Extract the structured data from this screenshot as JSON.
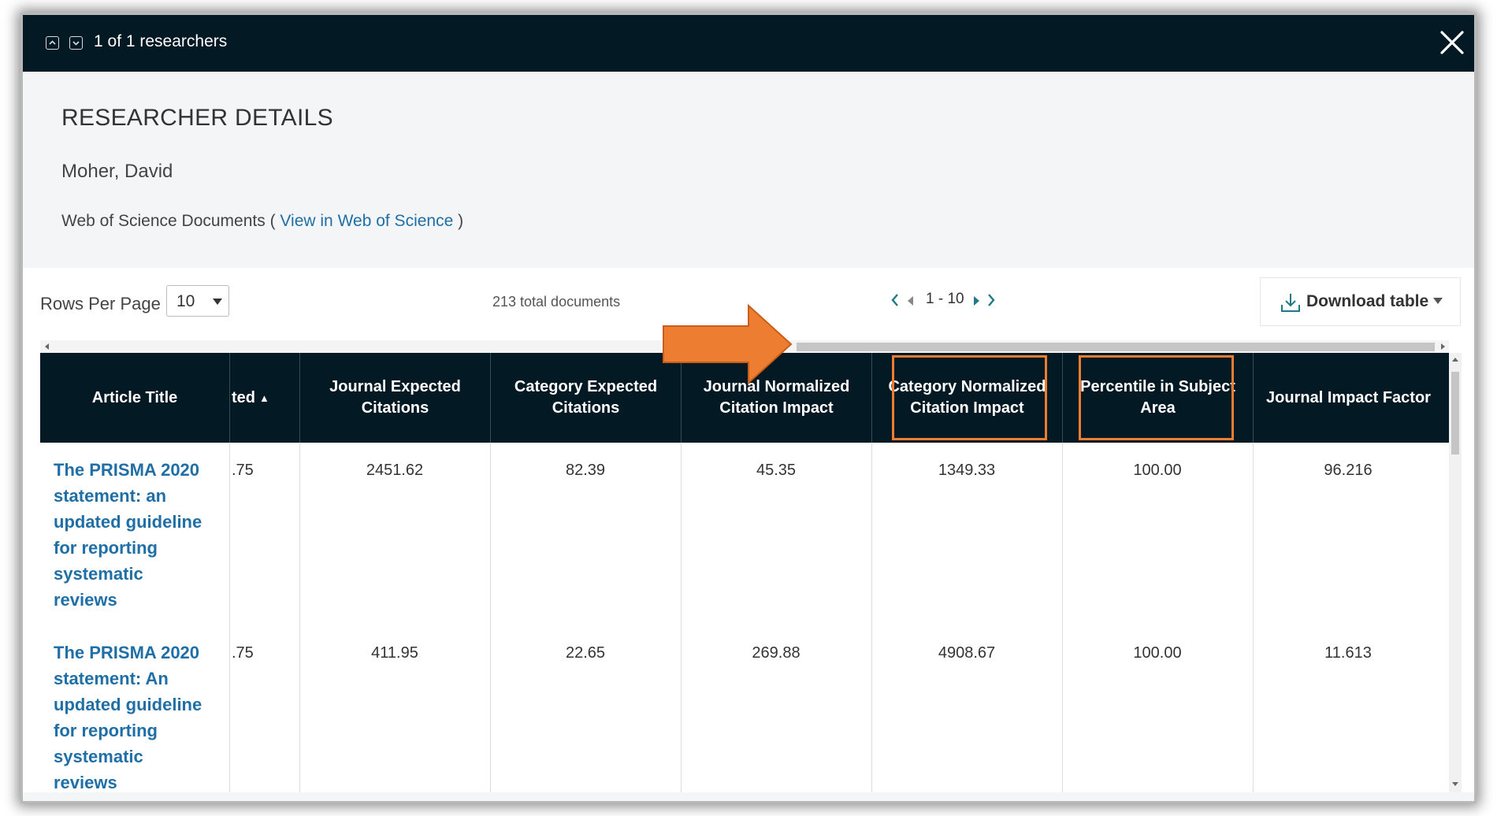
{
  "header": {
    "count_text": "1 of 1 researchers",
    "nav_up_icon": "chevron-up-square-icon",
    "nav_down_icon": "chevron-down-square-icon",
    "close_icon": "close-icon"
  },
  "details": {
    "section_title": "RESEARCHER DETAILS",
    "researcher_name": "Moher, David",
    "documents_prefix": "Web of Science Documents (",
    "view_link": "View in Web of Science",
    "documents_suffix": ")"
  },
  "controls": {
    "rows_per_page_label": "Rows Per Page",
    "rows_per_page_value": "10",
    "total_documents": "213 total documents",
    "page_range": "1 - 10",
    "download_label": "Download table"
  },
  "table": {
    "columns": [
      {
        "label": "Article Title"
      },
      {
        "label": "ted",
        "sortable": true
      },
      {
        "label": "Journal Expected Citations"
      },
      {
        "label": "Category Expected Citations"
      },
      {
        "label": "Journal Normalized Citation Impact"
      },
      {
        "label": "Category Normalized Citation Impact",
        "highlighted": true
      },
      {
        "label": "Percentile in Subject Area",
        "highlighted": true
      },
      {
        "label": "Journal Impact Factor"
      }
    ],
    "rows": [
      {
        "title": "The PRISMA 2020 statement: an updated guideline for reporting systematic reviews",
        "cited": ".75",
        "journal_expected": "2451.62",
        "category_expected": "82.39",
        "journal_normalized": "45.35",
        "category_normalized": "1349.33",
        "percentile": "100.00",
        "impact_factor": "96.216"
      },
      {
        "title": "The PRISMA 2020 statement: An updated guideline for reporting systematic reviews",
        "cited": ".75",
        "journal_expected": "411.95",
        "category_expected": "22.65",
        "journal_normalized": "269.88",
        "category_normalized": "4908.67",
        "percentile": "100.00",
        "impact_factor": "11.613"
      }
    ]
  },
  "colors": {
    "header_bg": "#031924",
    "link": "#1f6fa6",
    "highlight": "#ed7d31",
    "arrow": "#ed7d31"
  }
}
